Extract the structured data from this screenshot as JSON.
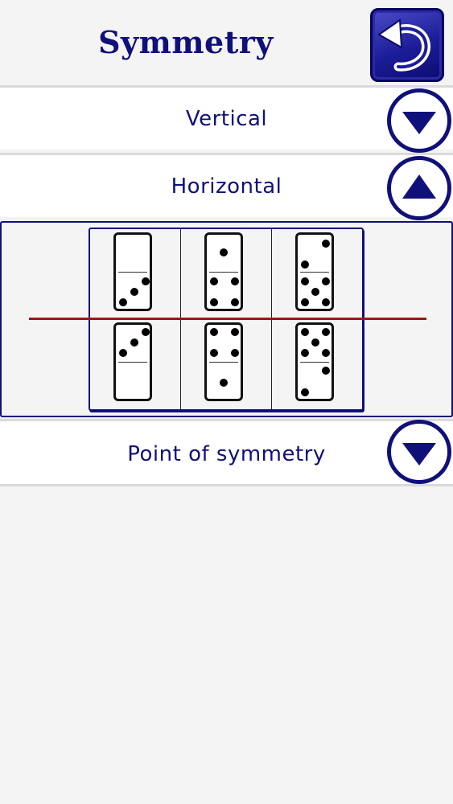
{
  "header": {
    "title": "Symmetry"
  },
  "sections": {
    "vertical": {
      "label": "Vertical",
      "expanded": false,
      "toggle_icon": "chevron-down-triangle-icon"
    },
    "horizontal": {
      "label": "Horizontal",
      "expanded": true,
      "toggle_icon": "chevron-up-triangle-icon"
    },
    "point": {
      "label": "Point of symmetry",
      "expanded": false,
      "toggle_icon": "chevron-down-triangle-icon"
    }
  },
  "horizontal_example": {
    "dominoes_top": [
      {
        "top_pips": 0,
        "bottom_pips": 3
      },
      {
        "top_pips": 1,
        "bottom_pips": 4
      },
      {
        "top_pips": 2,
        "bottom_pips": 5
      }
    ],
    "dominoes_bottom": [
      {
        "top_pips": 3,
        "bottom_pips": 0
      },
      {
        "top_pips": 4,
        "bottom_pips": 1
      },
      {
        "top_pips": 5,
        "bottom_pips": 2
      }
    ],
    "axis_color": "#a01414"
  },
  "colors": {
    "accent": "#10107a",
    "back_button": "#1c1c98",
    "background": "#f4f4f4"
  },
  "icons": {
    "back": "back-arrow-icon"
  }
}
